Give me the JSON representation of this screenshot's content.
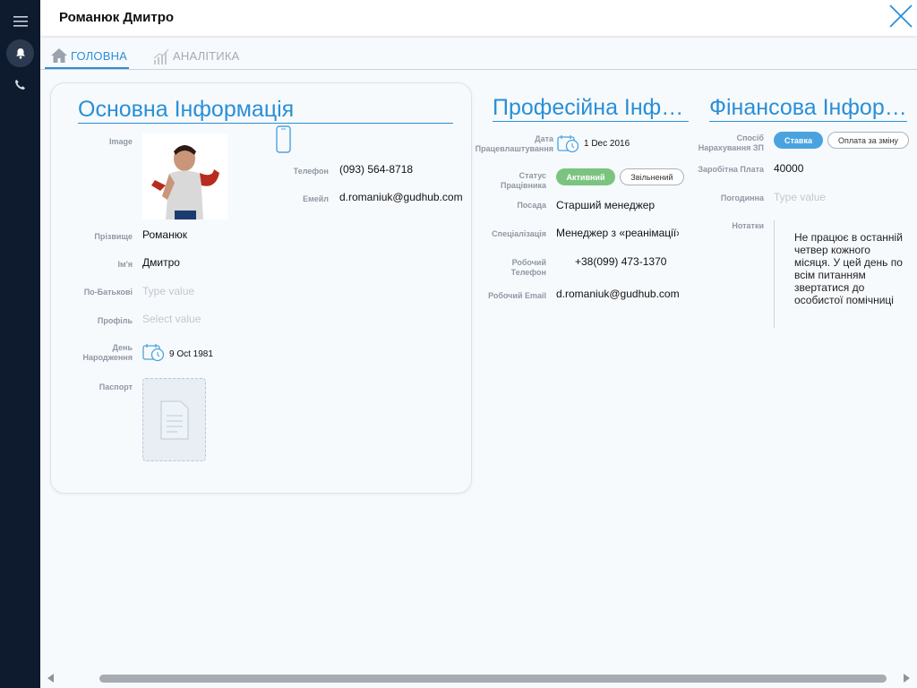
{
  "header": {
    "title": "Романюк Дмитро"
  },
  "tabs": [
    {
      "label": "ГОЛОВНА",
      "icon": "home-icon",
      "active": true
    },
    {
      "label": "АНАЛІТИКА",
      "icon": "analytics-icon",
      "active": false
    }
  ],
  "basic": {
    "title": "Основна Інформація",
    "image_label": "Image",
    "phone_label": "Телефон",
    "phone_value": "(093) 564-8718",
    "email_label": "Емейл",
    "email_value": "d.romaniuk@gudhub.com",
    "surname_label": "Прізвище",
    "surname_value": "Романюк",
    "name_label": "Ім'я",
    "name_value": "Дмитро",
    "patronymic_label": "По-Батькові",
    "patronymic_placeholder": "Type value",
    "profile_label": "Профіль",
    "profile_placeholder": "Select value",
    "birthday_label": "День Народження",
    "birthday_value": "9 Oct 1981",
    "passport_label": "Паспорт"
  },
  "professional": {
    "title": "Професійна Інформація",
    "hire_date_label": "Дата Працевлаштування",
    "hire_date_value": "1 Dec 2016",
    "status_label": "Статус Працівника",
    "status_options": [
      "Активний",
      "Звільнений"
    ],
    "position_label": "Посада",
    "position_value": "Старший менеджер",
    "specialization_label": "Спеціалізація",
    "specialization_value": "Менеджер з «реанімації»",
    "work_phone_label": "Робочий Телефон",
    "work_phone_value": "+38(099) 473-1370",
    "work_email_label": "Робочий Email",
    "work_email_value": "d.romaniuk@gudhub.com"
  },
  "financial": {
    "title": "Фінансова Інформація",
    "pay_method_label": "Спосіб Нарахування ЗП",
    "pay_options": [
      "Ставка",
      "Оплата за зміну"
    ],
    "salary_label": "Заробітна Плата",
    "salary_value": "40000",
    "hourly_label": "Погодинна",
    "hourly_placeholder": "Type value",
    "notes_label": "Нотатки",
    "notes_value": "Не працює в останній четвер кожного місяця. У цей день по всім питанням звертатися до особистої помічниці"
  },
  "colors": {
    "accent": "#2a8fd6",
    "rail": "#0e1a2e",
    "active_green": "#7bc47f",
    "active_blue": "#4aa3df"
  }
}
